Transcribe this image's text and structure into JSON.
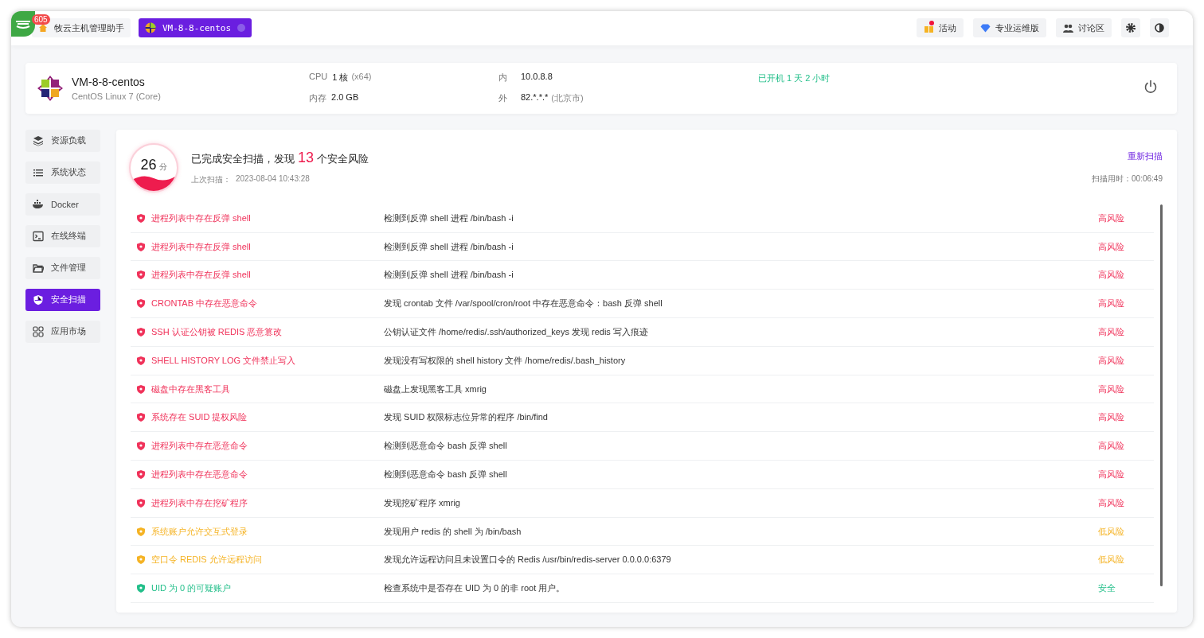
{
  "app": {
    "badge": "605"
  },
  "tabs": [
    {
      "label": "牧云主机管理助手",
      "selected": false
    },
    {
      "label": "VM-8-8-centos",
      "selected": true
    }
  ],
  "toolbar": [
    {
      "label": "活动",
      "notify": true
    },
    {
      "label": "专业运维版",
      "notify": false
    },
    {
      "label": "讨论区",
      "notify": false
    }
  ],
  "host": {
    "name": "VM-8-8-centos",
    "os": "CentOS Linux 7 (Core)",
    "cpu_label": "CPU",
    "cpu": "1 核",
    "cpu_arch": "(x64)",
    "mem_label": "内存",
    "mem": "2.0 GB",
    "ip_in_label": "内",
    "ip_in": "10.0.8.8",
    "ip_out_label": "外",
    "ip_out": "82.*.*.*",
    "ip_out_loc": "(北京市)",
    "uptime": "已开机 1 天 2 小时"
  },
  "sidebar": {
    "items": [
      {
        "label": "资源负载",
        "selected": false
      },
      {
        "label": "系统状态",
        "selected": false
      },
      {
        "label": "Docker",
        "selected": false
      },
      {
        "label": "在线终端",
        "selected": false
      },
      {
        "label": "文件管理",
        "selected": false
      },
      {
        "label": "安全扫描",
        "selected": true
      },
      {
        "label": "应用市场",
        "selected": false
      }
    ]
  },
  "scan": {
    "score": "26",
    "score_unit": "分",
    "summary_before": "已完成安全扫描，发现",
    "risk_count": "13",
    "summary_after": "个安全风险",
    "last_scan_label": "上次扫描：",
    "last_scan": "2023-08-04 10:43:28",
    "rescan": "重新扫描",
    "duration": "扫描用时：00:06:49"
  },
  "findings": [
    {
      "kind": "high",
      "name": "进程列表中存在反弹 shell",
      "detail": "检测到反弹 shell 进程 /bin/bash -i",
      "risk": "高风险"
    },
    {
      "kind": "high",
      "name": "进程列表中存在反弹 shell",
      "detail": "检测到反弹 shell 进程 /bin/bash -i",
      "risk": "高风险"
    },
    {
      "kind": "high",
      "name": "进程列表中存在反弹 shell",
      "detail": "检测到反弹 shell 进程 /bin/bash -i",
      "risk": "高风险"
    },
    {
      "kind": "high",
      "name": "CRONTAB 中存在恶意命令",
      "detail": "发现 crontab 文件 /var/spool/cron/root 中存在恶意命令：bash 反弹 shell",
      "risk": "高风险"
    },
    {
      "kind": "high",
      "name": "SSH 认证公钥被 REDIS 恶意篡改",
      "detail": "公钥认证文件 /home/redis/.ssh/authorized_keys 发现 redis 写入痕迹",
      "risk": "高风险"
    },
    {
      "kind": "high",
      "name": "SHELL HISTORY LOG 文件禁止写入",
      "detail": "发现没有写权限的 shell history 文件 /home/redis/.bash_history",
      "risk": "高风险"
    },
    {
      "kind": "high",
      "name": "磁盘中存在黑客工具",
      "detail": "磁盘上发现黑客工具 xmrig",
      "risk": "高风险"
    },
    {
      "kind": "high",
      "name": "系统存在 SUID 提权风险",
      "detail": "发现 SUID 权限标志位异常的程序 /bin/find",
      "risk": "高风险"
    },
    {
      "kind": "high",
      "name": "进程列表中存在恶意命令",
      "detail": "检测到恶意命令 bash 反弹 shell",
      "risk": "高风险"
    },
    {
      "kind": "high",
      "name": "进程列表中存在恶意命令",
      "detail": "检测到恶意命令 bash 反弹 shell",
      "risk": "高风险"
    },
    {
      "kind": "high",
      "name": "进程列表中存在挖矿程序",
      "detail": "发现挖矿程序 xmrig",
      "risk": "高风险"
    },
    {
      "kind": "low",
      "name": "系统账户允许交互式登录",
      "detail": "发现用户 redis 的 shell 为 /bin/bash",
      "risk": "低风险"
    },
    {
      "kind": "low",
      "name": "空口令 REDIS 允许远程访问",
      "detail": "发现允许远程访问且未设置口令的 Redis /usr/bin/redis-server 0.0.0.0:6379",
      "risk": "低风险"
    },
    {
      "kind": "safe",
      "name": "UID 为 0 的可疑账户",
      "detail": "检查系统中是否存在 UID 为 0 的非 root 用户。",
      "risk": "安全"
    }
  ]
}
